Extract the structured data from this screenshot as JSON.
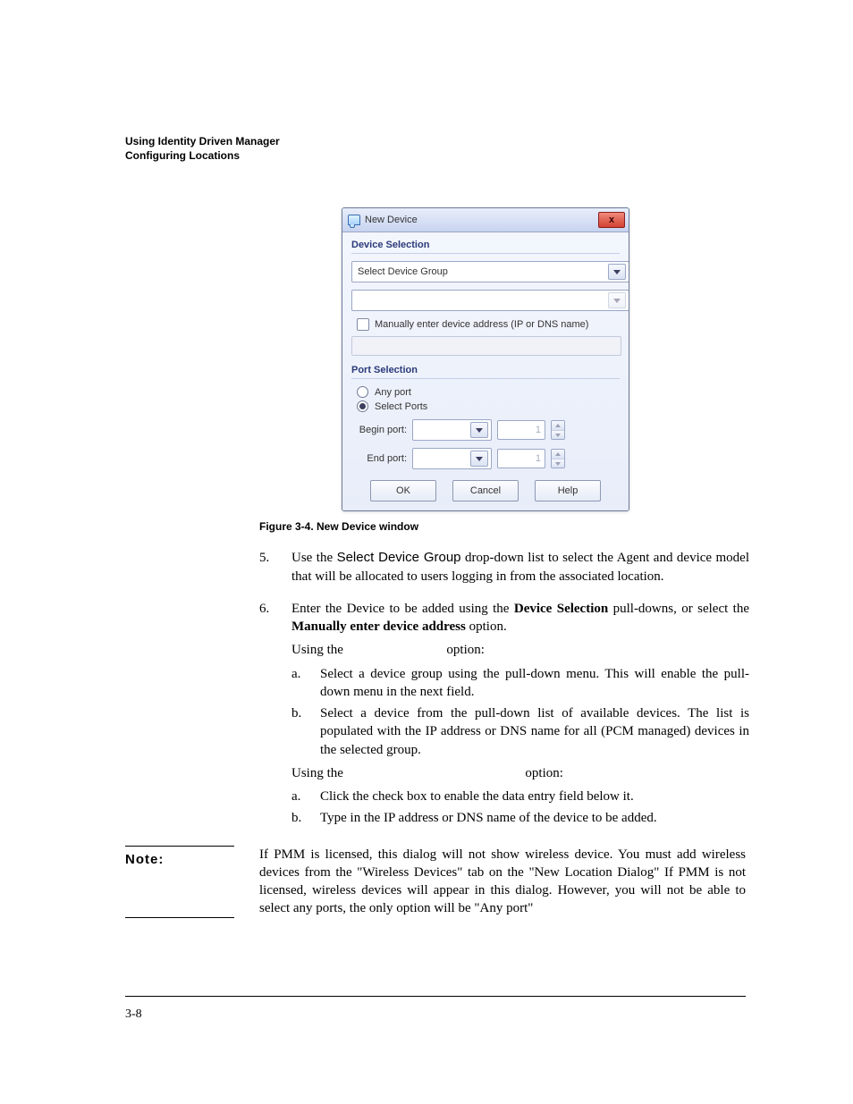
{
  "header": {
    "line1": "Using Identity Driven Manager",
    "line2": "Configuring Locations"
  },
  "dialog": {
    "title": "New Device",
    "section_device": "Device Selection",
    "device_group_placeholder": "Select Device Group",
    "manual_label": "Manually enter device address (IP or DNS name)",
    "section_port": "Port Selection",
    "radio_any": "Any port",
    "radio_select": "Select Ports",
    "begin_label": "Begin port:",
    "end_label": "End port:",
    "begin_value": "1",
    "end_value": "1",
    "ok": "OK",
    "cancel": "Cancel",
    "help": "Help"
  },
  "caption": "Figure 3-4. New Device window",
  "step5": {
    "num": "5.",
    "pre": "Use the ",
    "ui": "Select Device Group",
    "post": " drop-down list to select the Agent and device model that will be allocated to users logging in from the associated location."
  },
  "step6": {
    "num": "6.",
    "pre": "Enter the Device to be added using the ",
    "bold1": "Device Selection",
    "mid": " pull-downs, or select the ",
    "bold2": "Manually enter device address",
    "post": " option.",
    "using1_pre": "Using the ",
    "using1_post": " option:",
    "a1": {
      "n": "a.",
      "t": "Select a device group using the pull-down menu. This will enable the pull-down menu in the next field."
    },
    "b1": {
      "n": "b.",
      "t": "Select a device from the pull-down list of available devices. The list is populated with the IP address or DNS name for all (PCM managed) devices in the selected group."
    },
    "using2_pre": "Using the ",
    "using2_post": " option:",
    "a2": {
      "n": "a.",
      "t": "Click the check box to enable the data entry field below it."
    },
    "b2": {
      "n": "b.",
      "t": "Type in the IP address or DNS name of the device to be added."
    }
  },
  "note": {
    "label": "Note:",
    "text": "If PMM is licensed, this dialog will not show wireless device. You must add wireless devices from the \"Wireless Devices\" tab on the \"New Location Dialog\" If PMM is not licensed, wireless devices will appear in this dialog. However, you will not be able to select any ports, the only option will be \"Any port\""
  },
  "page": "3-8"
}
